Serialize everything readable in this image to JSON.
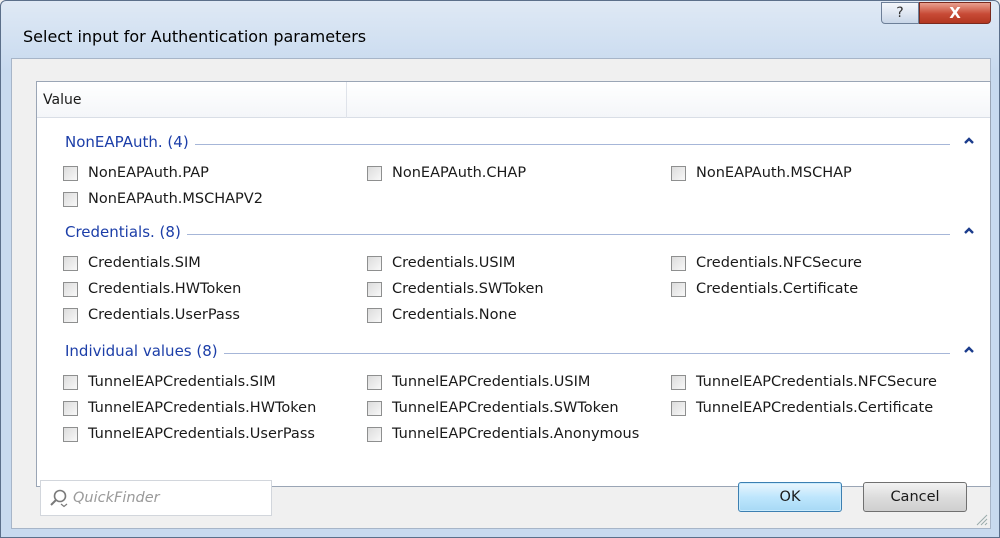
{
  "window": {
    "title": "Select input for Authentication parameters",
    "help_label": "?",
    "close_label": "X"
  },
  "table": {
    "column_header": "Value"
  },
  "groups": [
    {
      "title": "NonEAPAuth. (4)",
      "items": [
        "NonEAPAuth.PAP",
        "NonEAPAuth.CHAP",
        "NonEAPAuth.MSCHAP",
        "NonEAPAuth.MSCHAPV2"
      ]
    },
    {
      "title": "Credentials. (8)",
      "items": [
        "Credentials.SIM",
        "Credentials.USIM",
        "Credentials.NFCSecure",
        "Credentials.HWToken",
        "Credentials.SWToken",
        "Credentials.Certificate",
        "Credentials.UserPass",
        "Credentials.None"
      ]
    },
    {
      "title": "Individual values (8)",
      "items": [
        "TunnelEAPCredentials.SIM",
        "TunnelEAPCredentials.USIM",
        "TunnelEAPCredentials.NFCSecure",
        "TunnelEAPCredentials.HWToken",
        "TunnelEAPCredentials.SWToken",
        "TunnelEAPCredentials.Certificate",
        "TunnelEAPCredentials.UserPass",
        "TunnelEAPCredentials.Anonymous"
      ]
    }
  ],
  "footer": {
    "quickfinder_placeholder": "QuickFinder",
    "ok_label": "OK",
    "cancel_label": "Cancel"
  },
  "colors": {
    "group_title": "#1c3ea8",
    "collapse_icon": "#1b3c8c"
  }
}
